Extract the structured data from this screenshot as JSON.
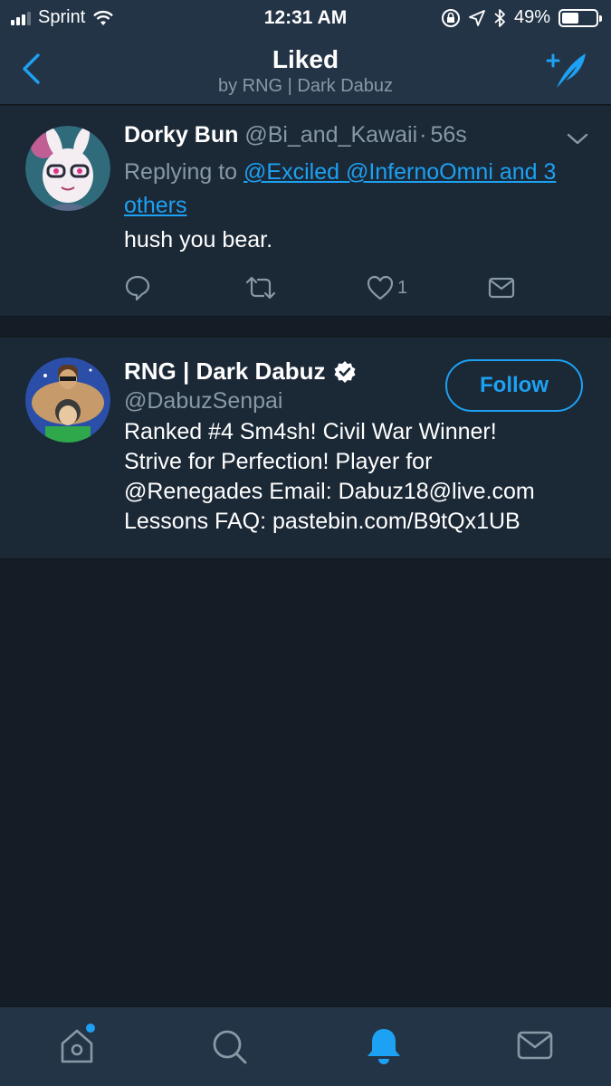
{
  "status_bar": {
    "carrier": "Sprint",
    "time": "12:31 AM",
    "battery_percent": "49%",
    "battery_level": 0.49
  },
  "nav": {
    "title": "Liked",
    "subtitle": "by RNG | Dark Dabuz"
  },
  "tweet": {
    "display_name": "Dorky Bun",
    "handle": "@Bi_and_Kawaii",
    "separator": "·",
    "time": "56s",
    "replying_prefix": "Replying to",
    "reply_mentions": "@Exciled @InfernoOmni and 3 others",
    "text": "hush you bear.",
    "like_count": "1"
  },
  "user": {
    "display_name": "RNG | Dark Dabuz",
    "handle": "@DabuzSenpai",
    "follow_label": "Follow",
    "bio_lines": [
      "Ranked #4 Sm4sh! Civil War Winner!",
      "Strive for Perfection! Player for",
      "@Renegades Email: Dabuz18@live.com",
      "Lessons FAQ: pastebin.com/B9tQx1UB"
    ]
  },
  "colors": {
    "background": "#141d26",
    "card": "#1b2836",
    "header": "#243447",
    "accent": "#1da1f2",
    "muted": "#8899a6"
  },
  "icons": {
    "tabs": [
      "home-icon",
      "search-icon",
      "notifications-bell-icon",
      "messages-envelope-icon"
    ]
  }
}
